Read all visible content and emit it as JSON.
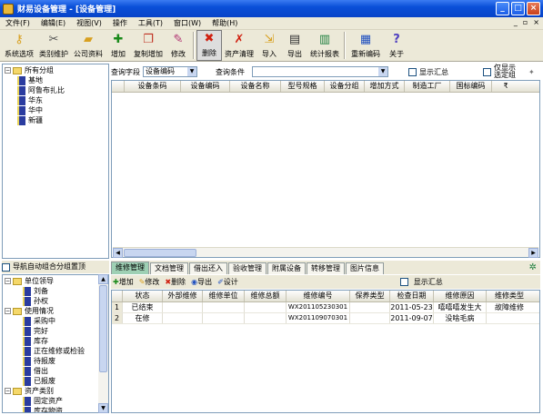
{
  "window": {
    "title": "财易设备管理 - [设备管理]"
  },
  "menu": [
    "文件(F)",
    "编辑(E)",
    "视图(V)",
    "操作",
    "工具(T)",
    "窗口(W)",
    "帮助(H)"
  ],
  "toolbar": [
    {
      "label": "系统选项",
      "icon": "key-icon"
    },
    {
      "label": "类别维护",
      "icon": "tools-icon"
    },
    {
      "label": "公司资料",
      "icon": "folder-icon"
    },
    {
      "label": "增加",
      "icon": "add-icon"
    },
    {
      "label": "复制增加",
      "icon": "copy-add-icon"
    },
    {
      "label": "修改",
      "icon": "pencil-icon"
    },
    {
      "label": "删除",
      "icon": "delete-icon"
    },
    {
      "label": "资产清理",
      "icon": "clear-icon"
    },
    {
      "label": "导入",
      "icon": "import-icon"
    },
    {
      "label": "导出",
      "icon": "export-icon"
    },
    {
      "label": "统计报表",
      "icon": "chart-icon"
    },
    {
      "label": "重新编码",
      "icon": "recode-icon"
    },
    {
      "label": "关于",
      "icon": "help-icon"
    }
  ],
  "tree_top": {
    "root": "所有分组",
    "items": [
      "基地",
      "阿鲁布扎比",
      "华东",
      "华中",
      "新疆"
    ]
  },
  "query": {
    "field_label": "查询字段",
    "field_value": "设备编码",
    "cond_label": "查询条件",
    "cond_value": "",
    "show_summary": "显示汇总",
    "only_selected": "仅显示选定组"
  },
  "grid1": {
    "columns": [
      "设备条码",
      "设备编码",
      "设备名称",
      "型号规格",
      "设备分组",
      "增加方式",
      "制造工厂",
      "国标编码",
      "₹"
    ]
  },
  "nav_bottom": {
    "header": "导航自动组合分组置顶",
    "sections": [
      {
        "label": "单位领导",
        "items": [
          "刘备",
          "孙权"
        ]
      },
      {
        "label": "使用情况",
        "items": [
          "采购中",
          "完好",
          "库存",
          "正在维修或检验",
          "待报废",
          "借出",
          "已报废"
        ]
      },
      {
        "label": "资产类别",
        "items": [
          "固定资产",
          "库存物资"
        ]
      }
    ]
  },
  "tabs": [
    "维修管理",
    "文档管理",
    "借出还入",
    "验收管理",
    "附属设备",
    "转移管理",
    "图片信息"
  ],
  "subtoolbar": {
    "add": "增加",
    "edit": "修改",
    "delete": "删除",
    "export": "导出",
    "design": "设计",
    "summary": "显示汇总"
  },
  "grid2": {
    "columns": [
      "状态",
      "外部维修",
      "维修单位",
      "维修总额",
      "维修编号",
      "保养类型",
      "检查日期",
      "维修原因",
      "维修类型"
    ],
    "rows": [
      {
        "idx": "1",
        "cells": [
          "已结束",
          "",
          "",
          "",
          "WX201105230301",
          "",
          "2011-05-23",
          "嘻嘻嘻发生大",
          "故障维修"
        ]
      },
      {
        "idx": "2",
        "cells": [
          "在修",
          "",
          "",
          "",
          "WX201109070301",
          "",
          "2011-09-07",
          "没啥毛病",
          ""
        ]
      }
    ]
  },
  "colors": {
    "titlebar": "#0a4fd8",
    "active_tab": "#9ed0b4",
    "panel": "#ece9d8"
  }
}
